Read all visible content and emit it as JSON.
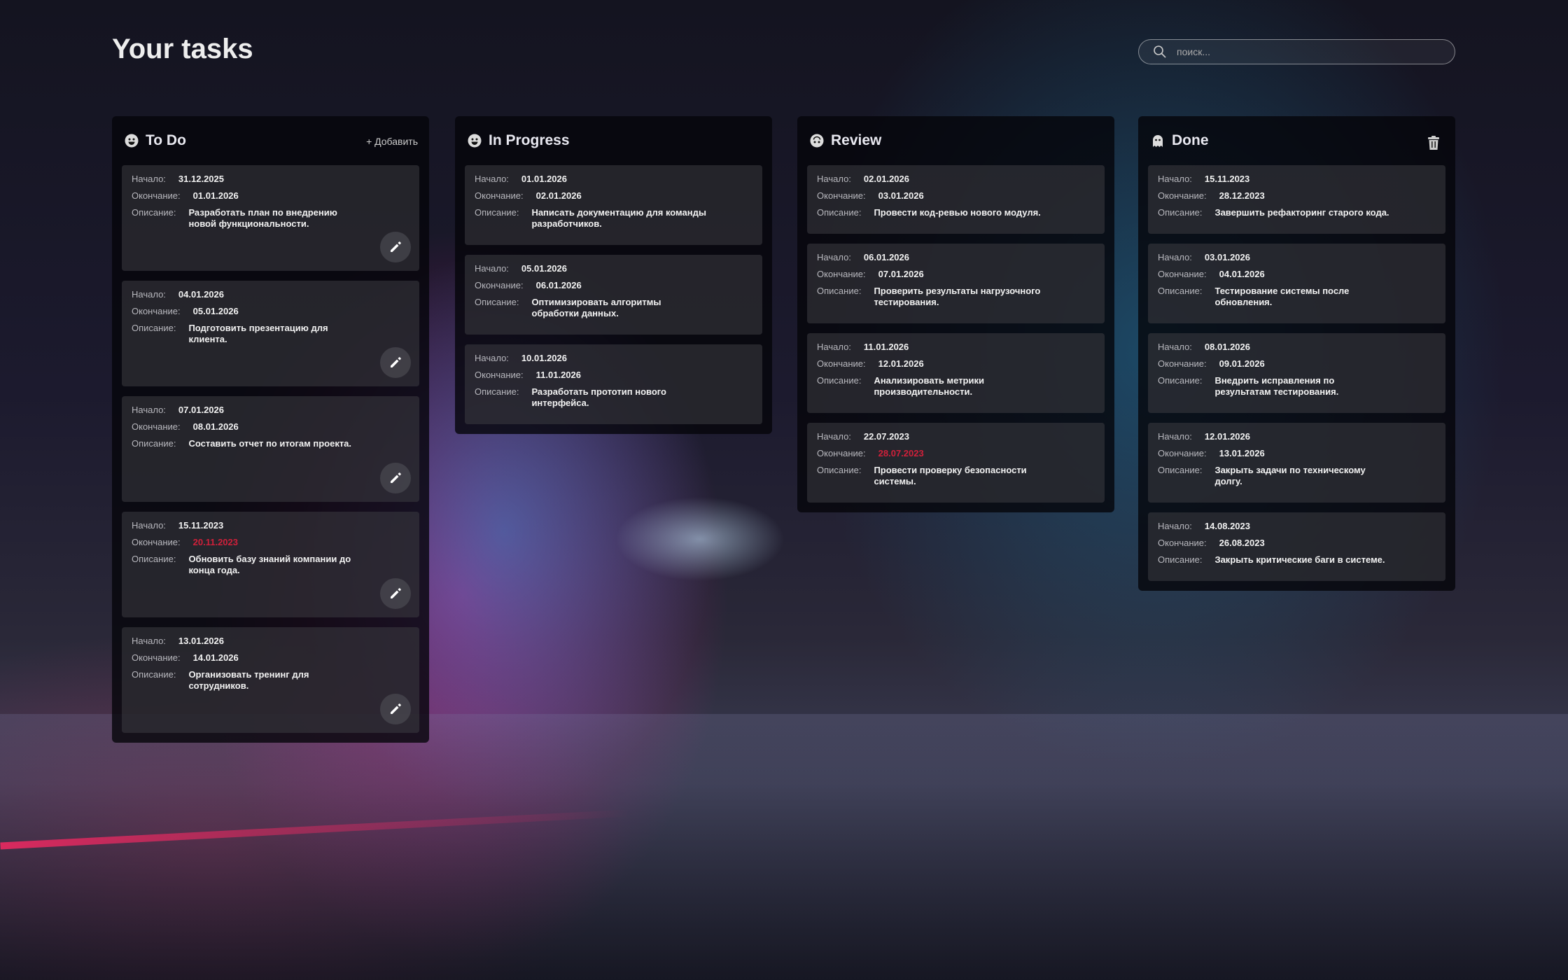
{
  "title": "Your tasks",
  "search": {
    "placeholder": "поиск..."
  },
  "labels": {
    "start": "Начало:",
    "end": "Окончание:",
    "desc": "Описание:"
  },
  "colors": {
    "overdue": "#d0203a"
  },
  "columns": [
    {
      "title": "To Do",
      "icon": "smile-icon",
      "action": "+ Добавить",
      "tasks": [
        {
          "start": "31.12.2025",
          "end": "01.01.2026",
          "desc": "Разработать план по внедрению новой функциональности."
        },
        {
          "start": "04.01.2026",
          "end": "05.01.2026",
          "desc": "Подготовить презентацию для клиента."
        },
        {
          "start": "07.01.2026",
          "end": "08.01.2026",
          "desc": "Составить отчет по итогам проекта."
        },
        {
          "start": "15.11.2023",
          "end": "20.11.2023",
          "desc": "Обновить базу знаний компании до конца года.",
          "overdue": true
        },
        {
          "start": "13.01.2026",
          "end": "14.01.2026",
          "desc": "Организовать тренинг для сотрудников."
        }
      ]
    },
    {
      "title": "In Progress",
      "icon": "smile-icon",
      "tasks": [
        {
          "start": "01.01.2026",
          "end": "02.01.2026",
          "desc": "Написать документацию для команды разработчиков."
        },
        {
          "start": "05.01.2026",
          "end": "06.01.2026",
          "desc": "Оптимизировать алгоритмы обработки данных."
        },
        {
          "start": "10.01.2026",
          "end": "11.01.2026",
          "desc": "Разработать прототип нового интерфейса."
        }
      ]
    },
    {
      "title": "Review",
      "icon": "upside-down-face-icon",
      "tasks": [
        {
          "start": "02.01.2026",
          "end": "03.01.2026",
          "desc": "Провести код-ревью нового модуля."
        },
        {
          "start": "06.01.2026",
          "end": "07.01.2026",
          "desc": "Проверить результаты нагрузочного тестирования."
        },
        {
          "start": "11.01.2026",
          "end": "12.01.2026",
          "desc": "Анализировать метрики производительности."
        },
        {
          "start": "22.07.2023",
          "end": "28.07.2023",
          "desc": "Провести проверку безопасности системы.",
          "overdue": true
        }
      ]
    },
    {
      "title": "Done",
      "icon": "ghost-icon",
      "tasks": [
        {
          "start": "15.11.2023",
          "end": "28.12.2023",
          "desc": "Завершить рефакторинг старого кода."
        },
        {
          "start": "03.01.2026",
          "end": "04.01.2026",
          "desc": "Тестирование системы после обновления."
        },
        {
          "start": "08.01.2026",
          "end": "09.01.2026",
          "desc": "Внедрить исправления по результатам тестирования."
        },
        {
          "start": "12.01.2026",
          "end": "13.01.2026",
          "desc": "Закрыть задачи по техническому долгу."
        },
        {
          "start": "14.08.2023",
          "end": "26.08.2023",
          "desc": "Закрыть критические баги в системе."
        }
      ]
    }
  ]
}
